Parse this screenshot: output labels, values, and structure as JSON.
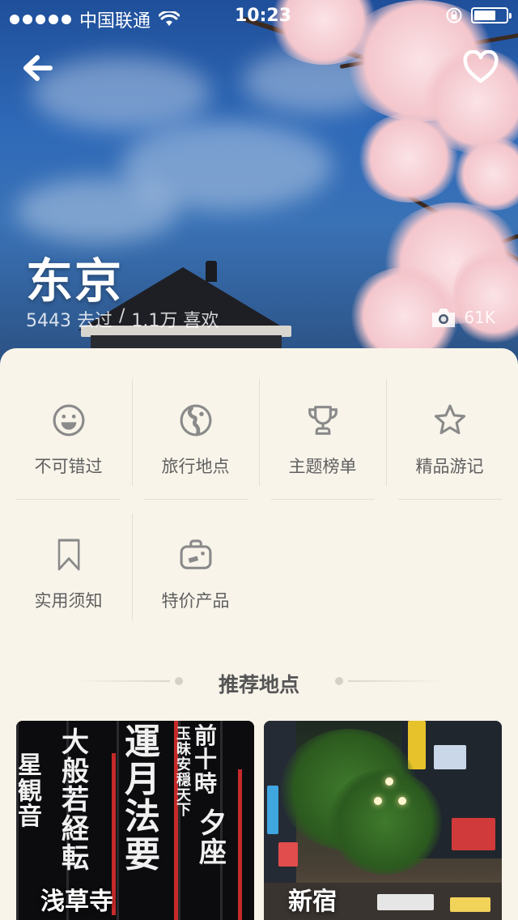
{
  "status_bar": {
    "carrier": "中国联通",
    "time": "10:23"
  },
  "city": {
    "name": "东京",
    "visited": "5443 去过",
    "separator": "/",
    "liked": "1.1万 喜欢",
    "photo_count": "61K"
  },
  "menu": {
    "items": [
      {
        "label": "不可错过",
        "icon": "smiley-icon"
      },
      {
        "label": "旅行地点",
        "icon": "globe-icon"
      },
      {
        "label": "主题榜单",
        "icon": "trophy-icon"
      },
      {
        "label": "精品游记",
        "icon": "star-icon"
      },
      {
        "label": "实用须知",
        "icon": "bookmark-icon"
      },
      {
        "label": "特价产品",
        "icon": "suitcase-icon"
      }
    ]
  },
  "recommended": {
    "title": "推荐地点",
    "cards": [
      {
        "label": "浅草寺"
      },
      {
        "label": "新宿"
      }
    ]
  },
  "colors": {
    "sheet_background": "#f8f4ea",
    "icon_gray": "#8a8a8a",
    "label_gray": "#5f5f5f"
  }
}
